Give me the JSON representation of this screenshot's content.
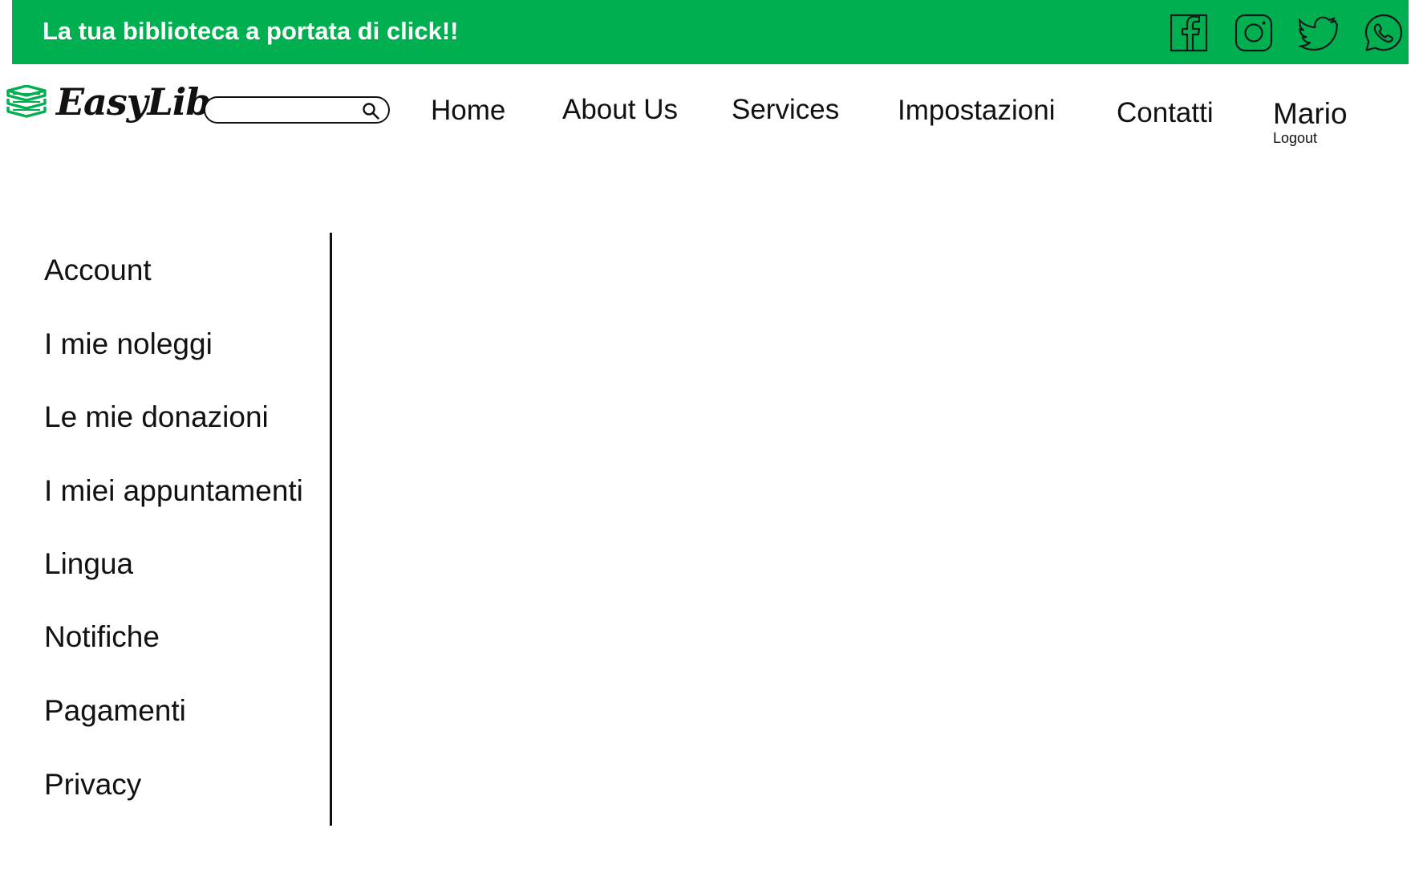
{
  "topbar": {
    "tagline": "La tua biblioteca a portata di click!!",
    "background_color": "#00b050",
    "social_icons": [
      "facebook-icon",
      "instagram-icon",
      "twitter-icon",
      "whatsapp-icon"
    ]
  },
  "header": {
    "logo_text": "EasyLib",
    "logo_icon": "books-icon",
    "logo_icon_color": "#00b050",
    "search": {
      "placeholder": "",
      "value": ""
    },
    "nav": [
      {
        "label": "Home"
      },
      {
        "label": "About Us"
      },
      {
        "label": "Services"
      },
      {
        "label": "Impostazioni"
      },
      {
        "label": "Contatti"
      }
    ],
    "user": {
      "name": "Mario",
      "logout_label": "Logout"
    }
  },
  "sidebar": {
    "items": [
      {
        "label": "Account"
      },
      {
        "label": "I mie noleggi"
      },
      {
        "label": "Le mie donazioni"
      },
      {
        "label": "I miei appuntamenti"
      },
      {
        "label": "Lingua"
      },
      {
        "label": "Notifiche"
      },
      {
        "label": "Pagamenti"
      },
      {
        "label": "Privacy"
      }
    ]
  }
}
